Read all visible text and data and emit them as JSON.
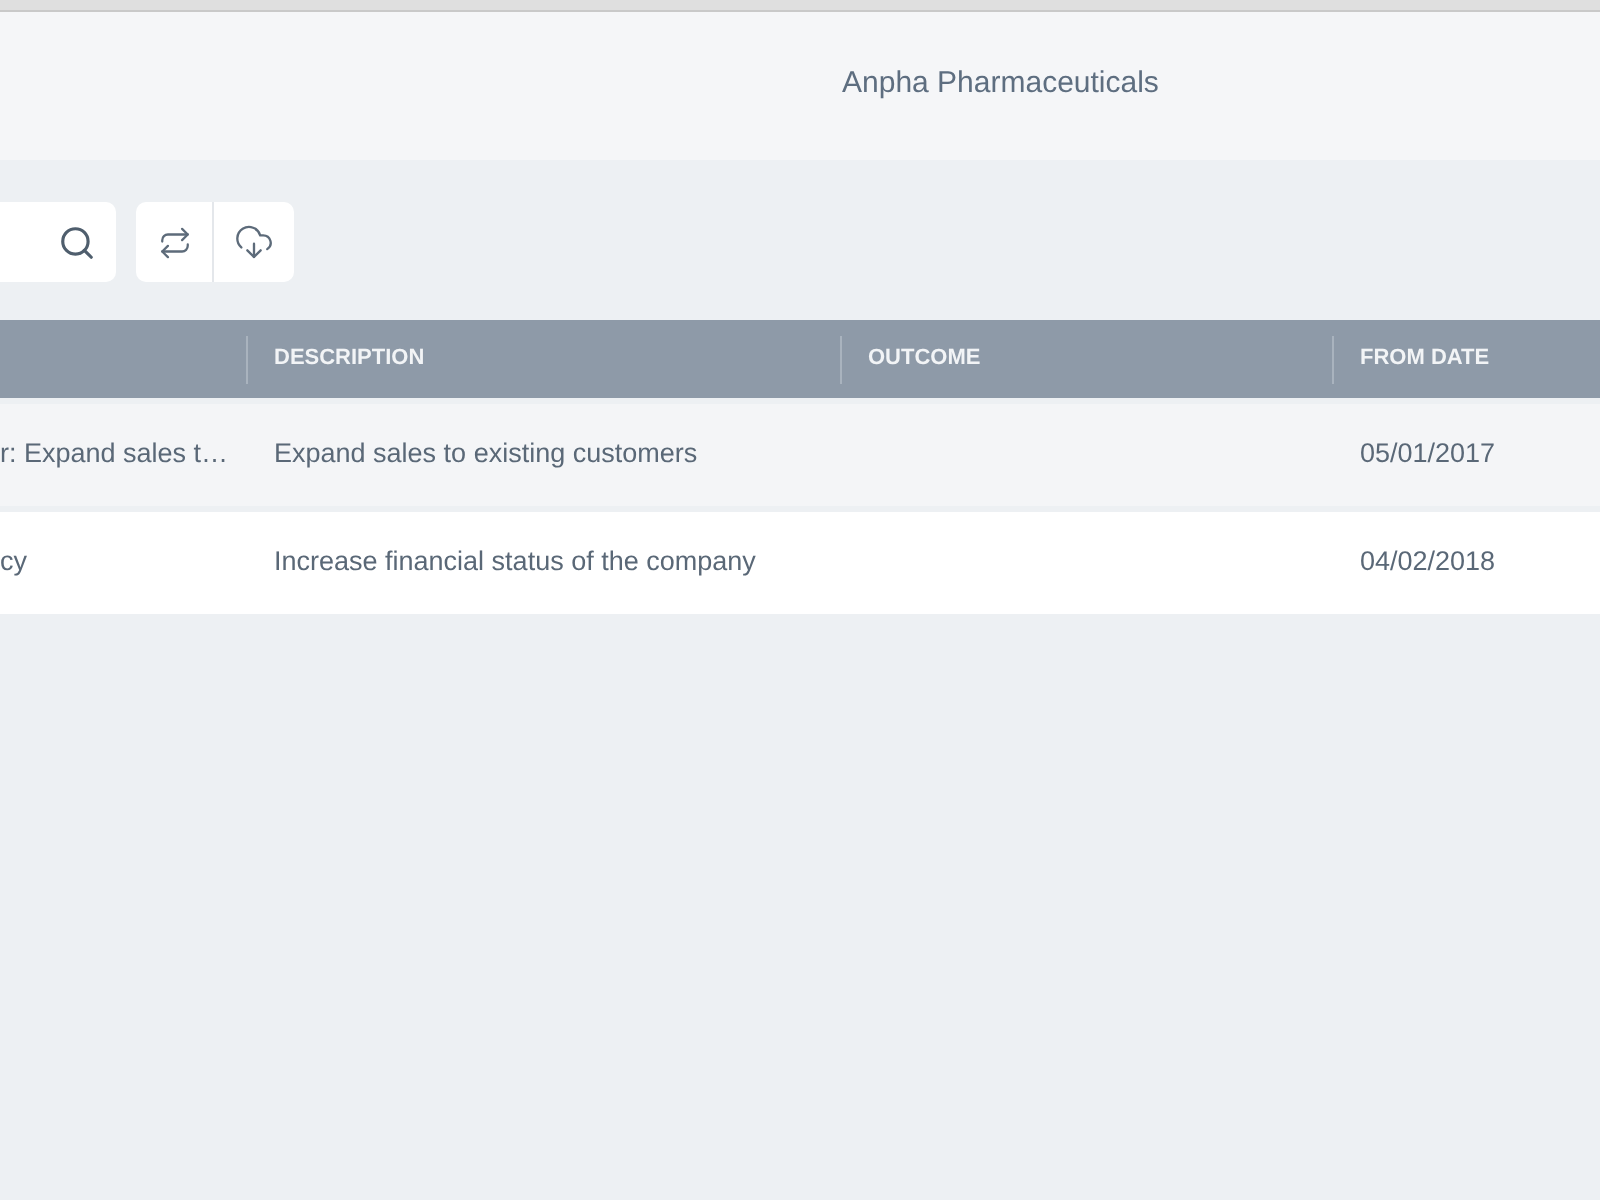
{
  "header": {
    "title": "Anpha Pharmaceuticals"
  },
  "table": {
    "columns": [
      "DESCRIPTION",
      "OUTCOME",
      "FROM DATE"
    ],
    "rows": [
      {
        "column_1": "r: Expand sales t…",
        "description": "Expand sales to existing customers",
        "from_date": "05/01/2017"
      },
      {
        "column_1": "cy",
        "description": "Increase financial status of the company",
        "from_date": "04/02/2018"
      }
    ]
  }
}
